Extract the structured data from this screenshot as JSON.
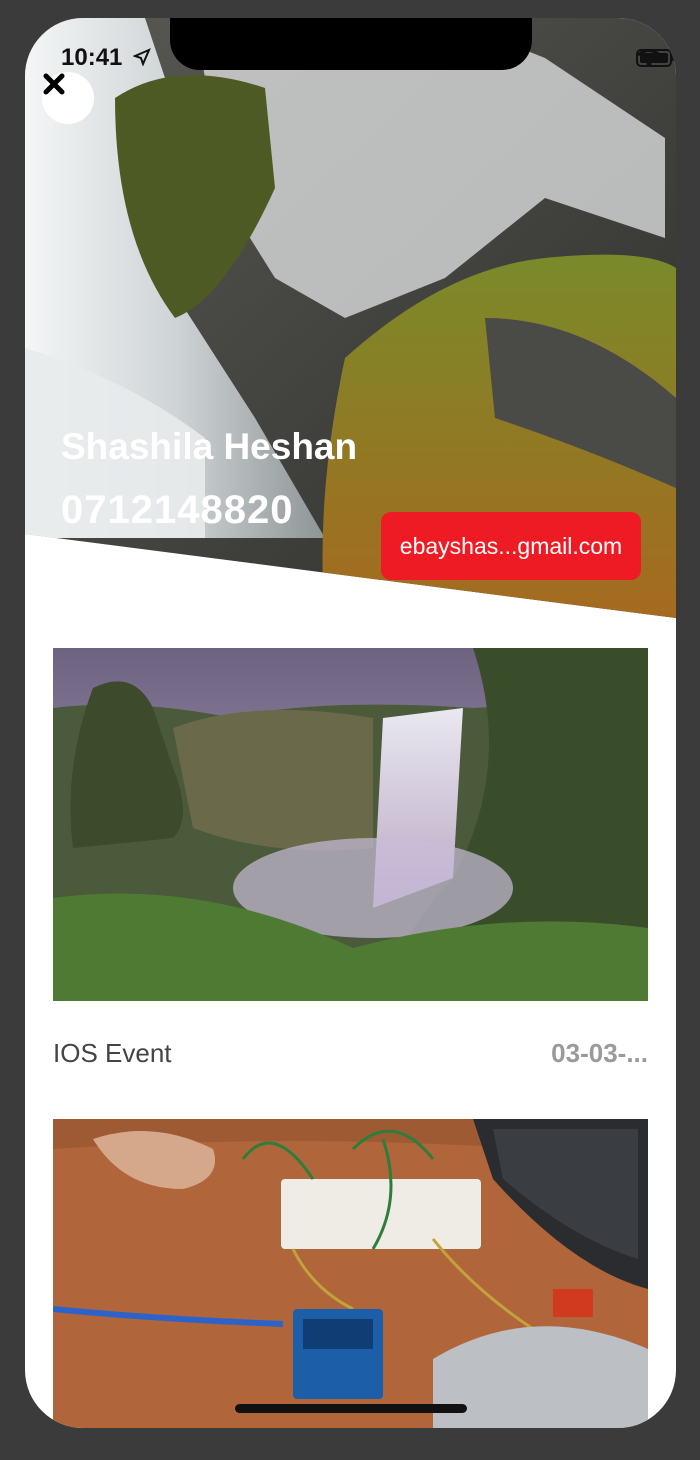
{
  "status_bar": {
    "time": "10:41"
  },
  "profile": {
    "name": "Shashila Heshan",
    "phone": "0712148820",
    "email_button": "ebayshas...gmail.com"
  },
  "events": [
    {
      "title": "IOS Event",
      "date": "03-03-..."
    },
    {
      "title": "",
      "date": ""
    }
  ],
  "colors": {
    "accent": "#ee1b24",
    "background": "#ffffff",
    "frame": "#3b3b3b"
  },
  "icons": {
    "close": "close-icon",
    "location": "location-arrow-icon",
    "wifi": "wifi-icon",
    "battery": "battery-icon"
  }
}
